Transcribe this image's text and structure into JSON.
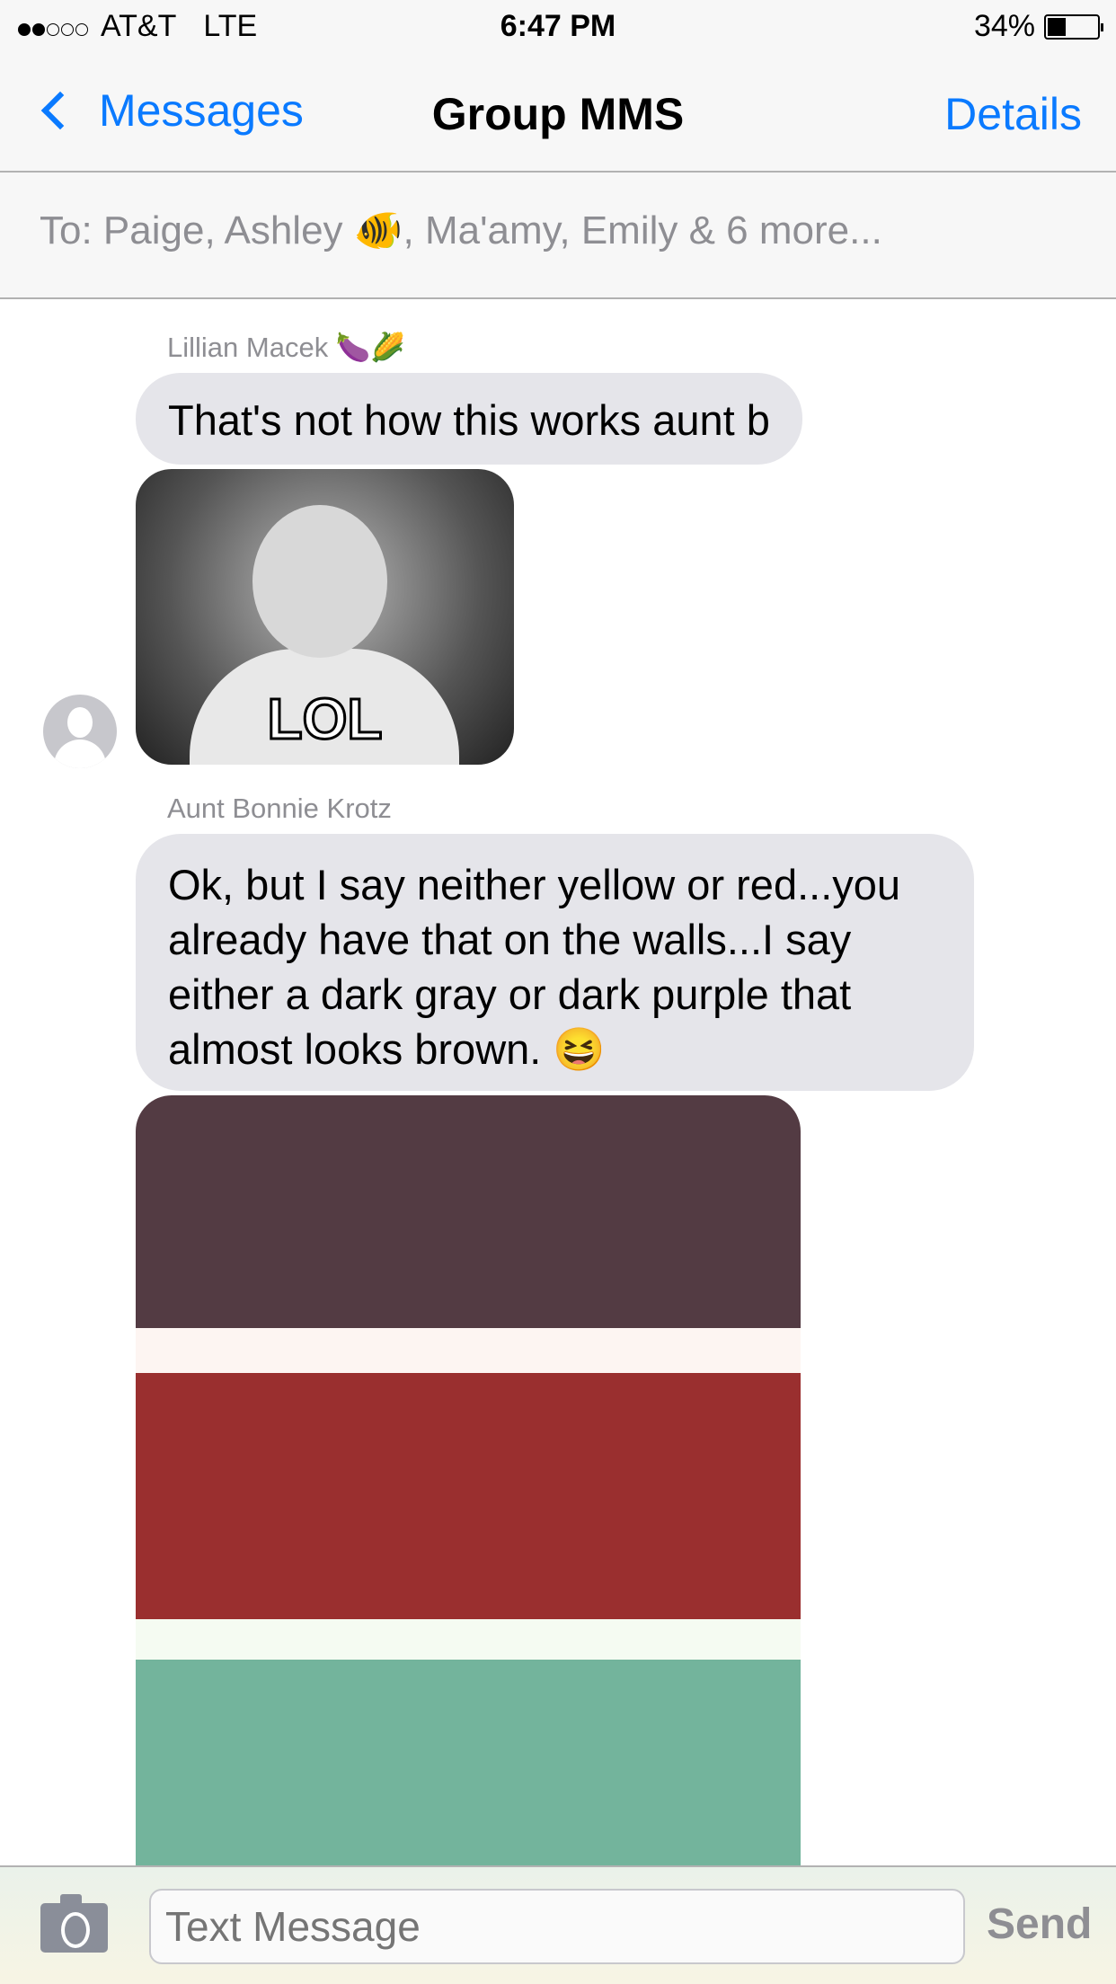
{
  "status": {
    "carrier": "AT&T",
    "network": "LTE",
    "time": "6:47 PM",
    "battery": "34%",
    "battery_level": 0.34,
    "signal_bars": 2
  },
  "nav": {
    "back": "Messages",
    "title": "Group MMS",
    "details": "Details"
  },
  "to": {
    "text": "To: Paige, Ashley 🐠, Ma'amy, Emily & 6 more..."
  },
  "messages": [
    {
      "sender": "Lillian Macek 🍆🌽",
      "text": "That's not how this works aunt b"
    },
    {
      "image_caption": "LOL"
    },
    {
      "sender": "Aunt Bonnie Krotz",
      "text": "Ok, but I say neither yellow or red...you already have that on the walls...I say either a dark gray or dark purple that almost looks brown.  😆"
    }
  ],
  "swatch_colors": [
    "#533b43",
    "#fdf5f2",
    "#9a2f2f",
    "#f5fbf2",
    "#73b49c"
  ],
  "composer": {
    "placeholder": "Text Message",
    "send": "Send"
  }
}
